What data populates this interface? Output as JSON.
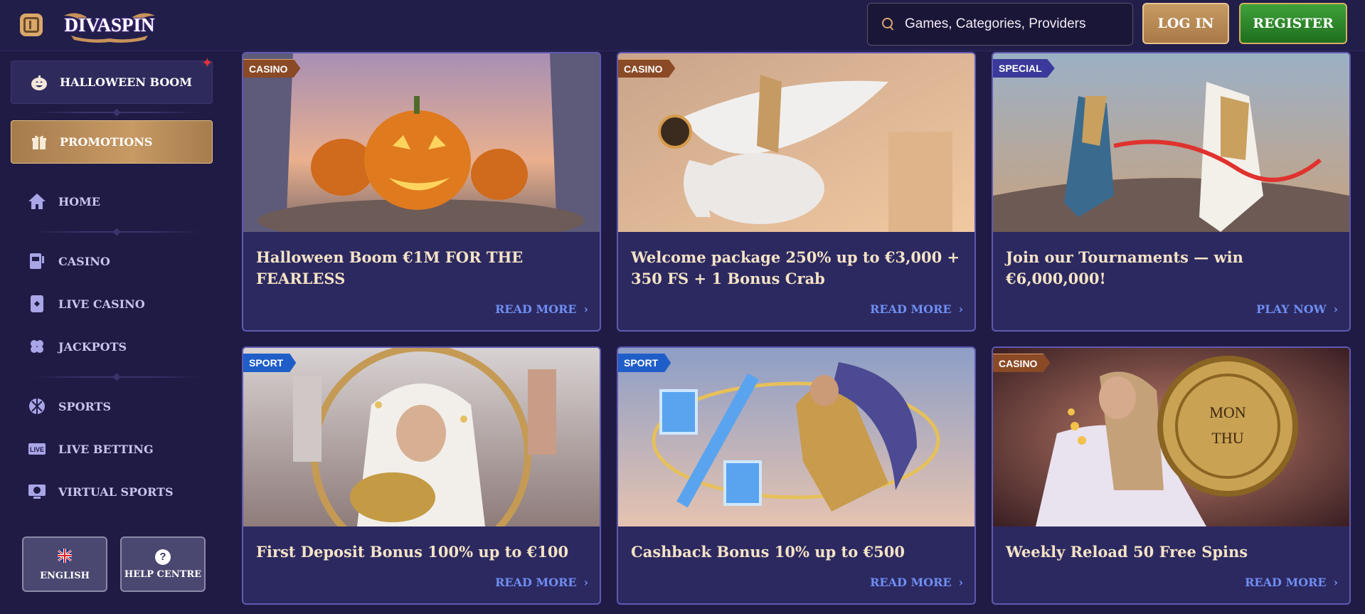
{
  "header": {
    "logo_text": "DIVASPIN",
    "search_placeholder": "Games, Categories, Providers",
    "login_label": "LOG IN",
    "register_label": "REGISTER"
  },
  "sidebar": {
    "highlights": [
      {
        "label": "HALLOWEEN BOOM",
        "icon": "pumpkin-icon"
      },
      {
        "label": "PROMOTIONS",
        "icon": "gift-icon"
      }
    ],
    "items": [
      {
        "label": "HOME",
        "icon": "home-icon"
      },
      {
        "label": "CASINO",
        "icon": "slot-machine-icon"
      },
      {
        "label": "LIVE CASINO",
        "icon": "playing-card-icon"
      },
      {
        "label": "JACKPOTS",
        "icon": "clover-icon"
      },
      {
        "label": "SPORTS",
        "icon": "ball-icon"
      },
      {
        "label": "LIVE BETTING",
        "icon": "live-icon"
      },
      {
        "label": "VIRTUAL SPORTS",
        "icon": "virtual-sports-icon"
      }
    ],
    "language_label": "ENGLISH",
    "help_label": "HELP CENTRE"
  },
  "promotions": [
    {
      "tag": "CASINO",
      "title": "Halloween Boom €1M FOR THE FEARLESS",
      "link": "READ MORE"
    },
    {
      "tag": "CASINO",
      "title": "Welcome package 250% up to €3,000 + 350 FS + 1 Bonus Crab",
      "link": "READ MORE"
    },
    {
      "tag": "SPECIAL",
      "title": "Join our Tournaments — win €6,000,000!",
      "link": "PLAY NOW"
    },
    {
      "tag": "SPORT",
      "title": "First Deposit Bonus 100% up to €100",
      "link": "READ MORE"
    },
    {
      "tag": "SPORT",
      "title": "Cashback Bonus 10% up to €500",
      "link": "READ MORE"
    },
    {
      "tag": "CASINO",
      "title": "Weekly Reload 50 Free Spins",
      "link": "READ MORE",
      "coin_text": [
        "MON",
        "THU"
      ]
    }
  ],
  "colors": {
    "background": "#1f1b45",
    "card_bg": "#2c2960",
    "card_border": "#5f5ab0",
    "title_text": "#f4e3c6",
    "link_text": "#6f8ef2",
    "gold_accent": "#c69a63",
    "register_green": "#2e8a2a"
  }
}
